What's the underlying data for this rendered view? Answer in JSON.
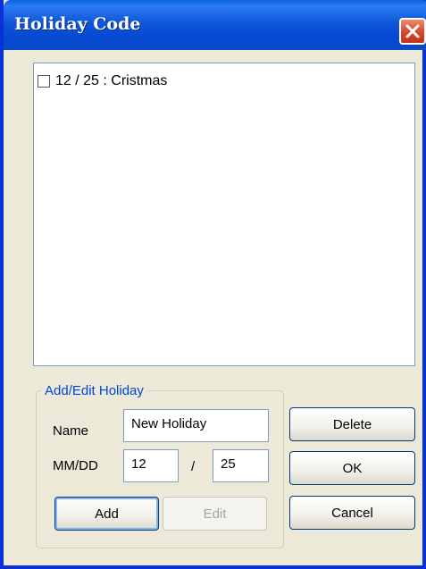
{
  "window": {
    "title": "Holiday Code"
  },
  "holiday_list": {
    "items": [
      {
        "label": "12 / 25 : Cristmas",
        "checked": false
      }
    ]
  },
  "edit_group": {
    "legend": "Add/Edit Holiday",
    "name_label": "Name",
    "name_value": "New Holiday",
    "date_label": "MM/DD",
    "month_value": "12",
    "separator": "/",
    "day_value": "25",
    "add_label": "Add",
    "edit_label": "Edit"
  },
  "buttons": {
    "delete_label": "Delete",
    "ok_label": "OK",
    "cancel_label": "Cancel"
  },
  "colors": {
    "title_bar": "#0348d0",
    "close_button": "#d8452a",
    "legend_text": "#0046d5"
  }
}
